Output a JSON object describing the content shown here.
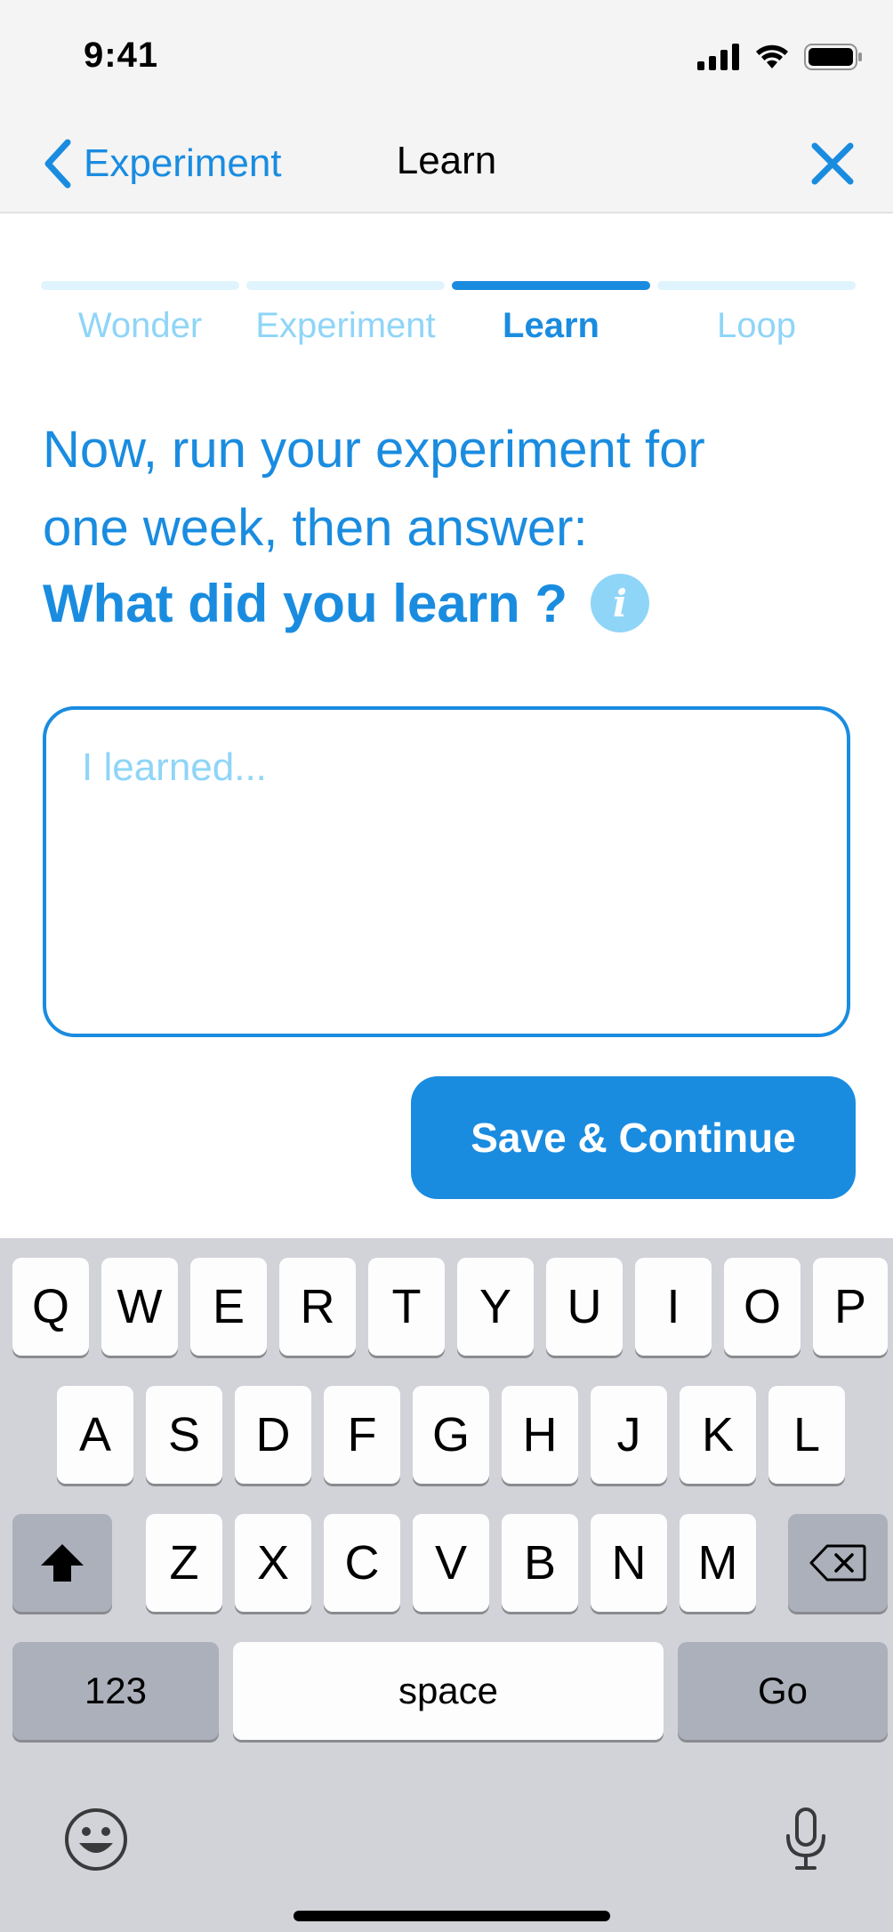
{
  "status_bar": {
    "time": "9:41"
  },
  "nav": {
    "back_label": "Experiment",
    "title": "Learn"
  },
  "steps": [
    {
      "label": "Wonder",
      "active": false
    },
    {
      "label": "Experiment",
      "active": false
    },
    {
      "label": "Learn",
      "active": true
    },
    {
      "label": "Loop",
      "active": false
    }
  ],
  "prompt": {
    "line1": "Now, run your experiment for",
    "line2": "one week, then answer:",
    "question": "What did you learn ?"
  },
  "answer": {
    "placeholder": "I learned...",
    "value": ""
  },
  "save_button": {
    "label": "Save & Continue"
  },
  "keyboard": {
    "row1": [
      "Q",
      "W",
      "E",
      "R",
      "T",
      "Y",
      "U",
      "I",
      "O",
      "P"
    ],
    "row2": [
      "A",
      "S",
      "D",
      "F",
      "G",
      "H",
      "J",
      "K",
      "L"
    ],
    "row3": [
      "Z",
      "X",
      "C",
      "V",
      "B",
      "N",
      "M"
    ],
    "numbers_label": "123",
    "space_label": "space",
    "go_label": "Go"
  },
  "colors": {
    "accent": "#1a8ce0",
    "accent_light": "#8fd5f7",
    "step_inactive": "#dff4fd"
  }
}
